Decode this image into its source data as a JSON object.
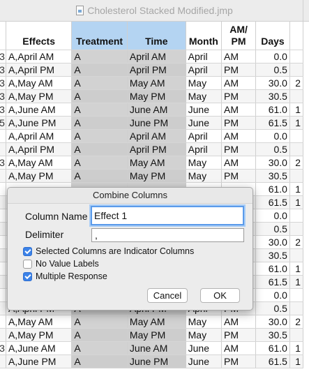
{
  "window": {
    "title": "Cholesterol Stacked Modified.jmp"
  },
  "grid": {
    "columns": [
      "",
      "Effects",
      "Treatment",
      "Time",
      "Month",
      "AM/\nPM",
      "Days",
      ""
    ],
    "rows_top": [
      [
        "3",
        "A,April AM",
        "A",
        "April AM",
        "April",
        "AM",
        "0.0",
        ""
      ],
      [
        "3",
        "A,April PM",
        "A",
        "April PM",
        "April",
        "PM",
        "0.5",
        ""
      ],
      [
        "3",
        "A,May AM",
        "A",
        "May AM",
        "May",
        "AM",
        "30.0",
        "2"
      ],
      [
        "3",
        "A,May PM",
        "A",
        "May PM",
        "May",
        "PM",
        "30.5",
        ""
      ],
      [
        "3",
        "A,June AM",
        "A",
        "June AM",
        "June",
        "AM",
        "61.0",
        "1"
      ],
      [
        "5",
        "A,June PM",
        "A",
        "June PM",
        "June",
        "PM",
        "61.5",
        "1"
      ],
      [
        "",
        "A,April AM",
        "A",
        "April AM",
        "April",
        "AM",
        "0.0",
        ""
      ],
      [
        "",
        "A,April PM",
        "A",
        "April PM",
        "April",
        "PM",
        "0.5",
        ""
      ],
      [
        "3",
        "A,May AM",
        "A",
        "May AM",
        "May",
        "AM",
        "30.0",
        "2"
      ],
      [
        "",
        "A,May PM",
        "A",
        "May PM",
        "May",
        "PM",
        "30.5",
        ""
      ],
      [
        "",
        "",
        "",
        "",
        "",
        "",
        "61.0",
        "1"
      ],
      [
        "",
        "",
        "",
        "",
        "",
        "",
        "61.5",
        "1"
      ],
      [
        "",
        "",
        "",
        "",
        "",
        "",
        "0.0",
        ""
      ],
      [
        "",
        "",
        "",
        "",
        "",
        "",
        "0.5",
        ""
      ],
      [
        "",
        "",
        "",
        "",
        "",
        "",
        "30.0",
        "2"
      ],
      [
        "",
        "",
        "",
        "",
        "",
        "",
        "30.5",
        ""
      ],
      [
        "",
        "",
        "",
        "",
        "",
        "",
        "61.0",
        "1"
      ],
      [
        "",
        "",
        "",
        "",
        "",
        "",
        "61.5",
        "1"
      ],
      [
        "",
        "A,April AM",
        "A",
        "April AM",
        "April",
        "AM",
        "0.0",
        ""
      ],
      [
        "",
        "A,April PM",
        "A",
        "April PM",
        "April",
        "PM",
        "0.5",
        ""
      ],
      [
        "",
        "A,May AM",
        "A",
        "May AM",
        "May",
        "AM",
        "30.0",
        "2"
      ],
      [
        "",
        "A,May PM",
        "A",
        "May PM",
        "May",
        "PM",
        "30.5",
        ""
      ],
      [
        "3",
        "A,June AM",
        "A",
        "June AM",
        "June",
        "AM",
        "61.0",
        "1"
      ],
      [
        "",
        "A,June PM",
        "A",
        "June PM",
        "June",
        "PM",
        "61.5",
        "1"
      ]
    ],
    "selected_columns": [
      2,
      3
    ]
  },
  "dialog": {
    "title": "Combine Columns",
    "column_name_label": "Column Name",
    "column_name_value": "Effect 1",
    "delimiter_label": "Delimiter",
    "delimiter_value": ",",
    "options": [
      {
        "label": "Selected Columns are Indicator Columns",
        "checked": true
      },
      {
        "label": "No Value Labels",
        "checked": false
      },
      {
        "label": "Multiple Response",
        "checked": true
      }
    ],
    "cancel_label": "Cancel",
    "ok_label": "OK"
  }
}
